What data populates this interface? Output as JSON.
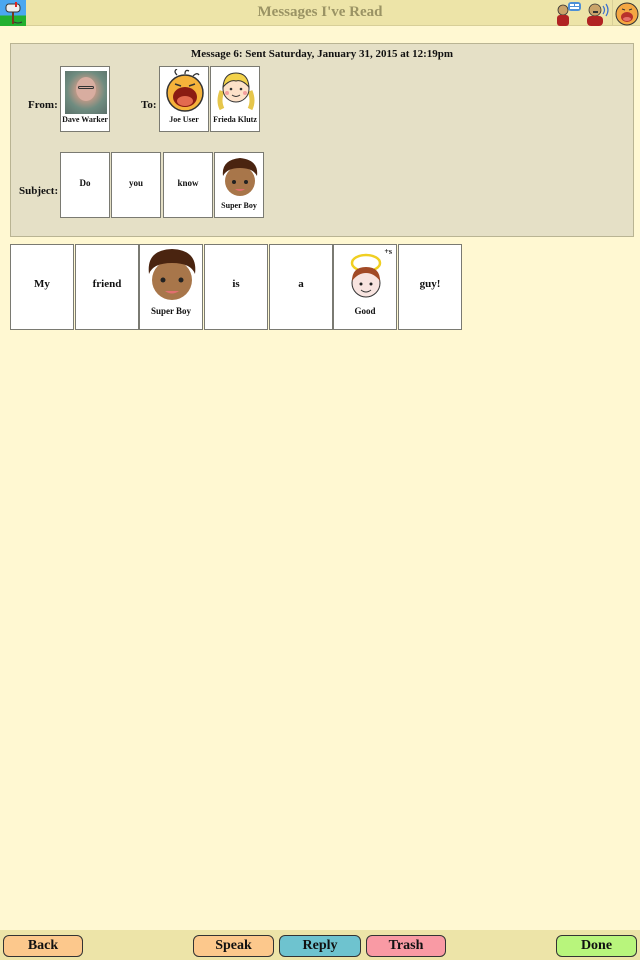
{
  "header": {
    "title": "Messages I've Read",
    "left_icon": "mailbox-icon",
    "right_icons": [
      "chat-icon",
      "speak-icon",
      "user-avatar-icon"
    ]
  },
  "message": {
    "heading": "Message 6: Sent Saturday, January 31, 2015 at 12:19pm",
    "from_label": "From:",
    "to_label": "To:",
    "subject_label": "Subject:",
    "from": [
      {
        "name": "Dave Warker",
        "icon": "photo-dave-warker"
      }
    ],
    "to": [
      {
        "name": "Joe User",
        "icon": "laughing-face-icon"
      },
      {
        "name": "Frieda Klutz",
        "icon": "girl-pigtails-icon"
      }
    ],
    "subject": [
      {
        "word": "Do"
      },
      {
        "word": "you"
      },
      {
        "word": "know"
      },
      {
        "word": "Super Boy",
        "icon": "super-boy-icon"
      }
    ],
    "body": [
      {
        "word": "My"
      },
      {
        "word": "friend"
      },
      {
        "word": "Super Boy",
        "icon": "super-boy-icon"
      },
      {
        "word": "is"
      },
      {
        "word": "a"
      },
      {
        "word": "Good",
        "icon": "angel-face-icon",
        "badge": "+s"
      },
      {
        "word": "guy!"
      }
    ]
  },
  "footer": {
    "back": "Back",
    "speak": "Speak",
    "reply": "Reply",
    "trash": "Trash",
    "done": "Done"
  },
  "colors": {
    "background": "#fff8d2",
    "header": "#ede4a8",
    "panel": "#e5e0c6",
    "back_button": "#fcc88c",
    "speak_button": "#fcc88c",
    "reply_button": "#6ec3cf",
    "trash_button": "#f99aa4",
    "done_button": "#b8f57c"
  }
}
